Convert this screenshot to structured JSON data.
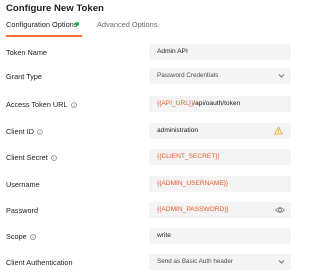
{
  "header": {
    "title": "Configure New Token"
  },
  "tabs": [
    {
      "label": "Configuration Options",
      "active": true,
      "status_color": "#0cbb52"
    },
    {
      "label": "Advanced Options",
      "active": false
    }
  ],
  "accent_color": "#ff6c37",
  "variable_color": "#e35b29",
  "fields": {
    "token_name": {
      "label": "Token Name",
      "value": "Admin API"
    },
    "grant_type": {
      "label": "Grant Type",
      "value": "Password Credentials",
      "icon": "chevron-down-icon"
    },
    "access_token_url": {
      "label": "Access Token URL",
      "value_var": "{{API_URL}}",
      "value_rest": "/api/oauth/token",
      "icon": "info-icon"
    },
    "client_id": {
      "label": "Client ID",
      "value": "administration",
      "icon": "info-icon",
      "warning_icon": "warning-icon"
    },
    "client_secret": {
      "label": "Client Secret",
      "value": "{{CLIENT_SECRET}}",
      "icon": "info-icon"
    },
    "username": {
      "label": "Username",
      "value": "{{ADMIN_USERNAME}}"
    },
    "password": {
      "label": "Password",
      "value": "{{ADMIN_PASSWORD}}",
      "icon": "eye-icon"
    },
    "scope": {
      "label": "Scope",
      "value": "write",
      "icon": "info-icon"
    },
    "client_authentication": {
      "label": "Client Authentication",
      "value": "Send as Basic Auth header",
      "icon": "chevron-down-icon"
    }
  }
}
